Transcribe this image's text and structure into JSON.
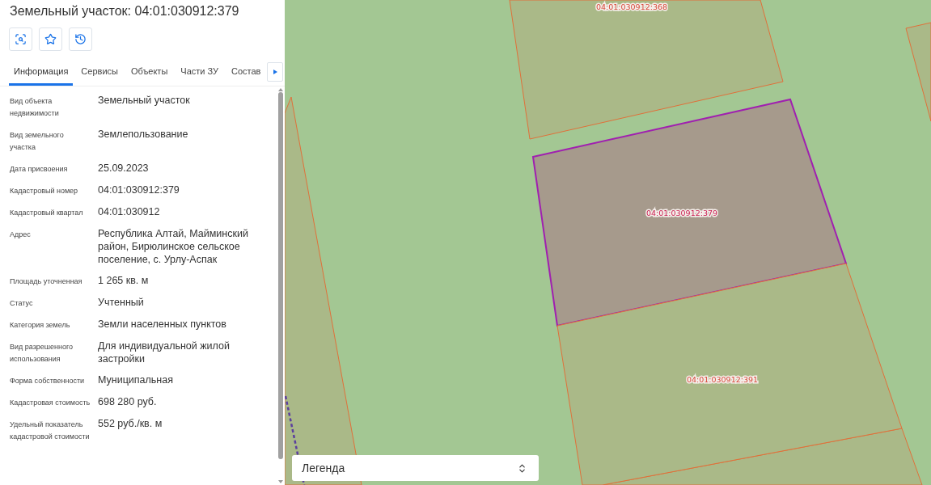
{
  "title": "Земельный участок: 04:01:030912:379",
  "tabs": [
    {
      "label": "Информация",
      "selected": true
    },
    {
      "label": "Сервисы",
      "selected": false
    },
    {
      "label": "Объекты",
      "selected": false
    },
    {
      "label": "Части ЗУ",
      "selected": false
    },
    {
      "label": "Состав",
      "selected": false
    }
  ],
  "properties": [
    {
      "label": "Вид объекта недвижимости",
      "value": "Земельный участок"
    },
    {
      "label": "Вид земельного участка",
      "value": "Землепользование"
    },
    {
      "label": "Дата присвоения",
      "value": "25.09.2023"
    },
    {
      "label": "Кадастровый номер",
      "value": "04:01:030912:379"
    },
    {
      "label": "Кадастровый квартал",
      "value": "04:01:030912"
    },
    {
      "label": "Адрес",
      "value": "Республика Алтай, Майминский район, Бирюлинское сельское поселение, с. Урлу-Аспак"
    },
    {
      "label": "Площадь уточненная",
      "value": "1 265 кв. м"
    },
    {
      "label": "Статус",
      "value": "Учтенный"
    },
    {
      "label": "Категория земель",
      "value": "Земли населенных пунктов"
    },
    {
      "label": "Вид разрешенного использования",
      "value": "Для индивидуальной жилой застройки"
    },
    {
      "label": "Форма собственности",
      "value": "Муниципальная"
    },
    {
      "label": "Кадастровая стоимость",
      "value": "698 280 руб."
    },
    {
      "label": "Удельный показатель кадастровой стоимости",
      "value": "552 руб./кв. м"
    }
  ],
  "map": {
    "parcels": [
      {
        "label": "04:01:030912:368",
        "selected": false
      },
      {
        "label": "04:01:030912:379",
        "selected": true
      },
      {
        "label": "04:01:030912:391",
        "selected": false
      }
    ]
  },
  "legend": {
    "label": "Легенда"
  }
}
